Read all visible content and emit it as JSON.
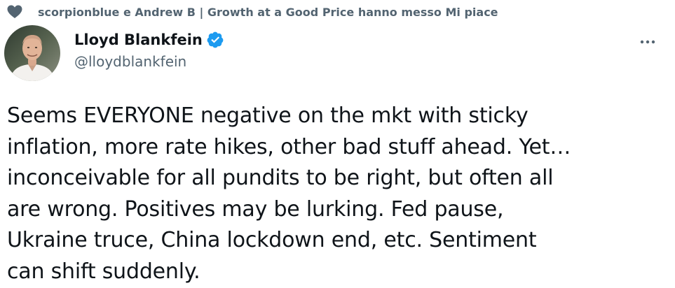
{
  "social_context": {
    "icon": "heart-icon",
    "text": "scorpionblue e Andrew B | Growth at a Good Price hanno messo Mi piace"
  },
  "author": {
    "display_name": "Lloyd Blankfein",
    "handle": "@lloydblankfein",
    "verified": true,
    "verified_color": "#1d9bf0"
  },
  "tweet": {
    "text": "Seems EVERYONE negative on the mkt with sticky\ninflation, more rate hikes, other bad stuff ahead. Yet…\ninconceivable for all pundits to be right, but often all\nare wrong. Positives may be lurking. Fed pause,\nUkraine truce, China lockdown end, etc. Sentiment\ncan shift suddenly."
  },
  "menu": {
    "icon": "more-horizontal-icon"
  },
  "colors": {
    "primary_text": "#0f1419",
    "secondary_text": "#536471",
    "accent": "#1d9bf0"
  }
}
